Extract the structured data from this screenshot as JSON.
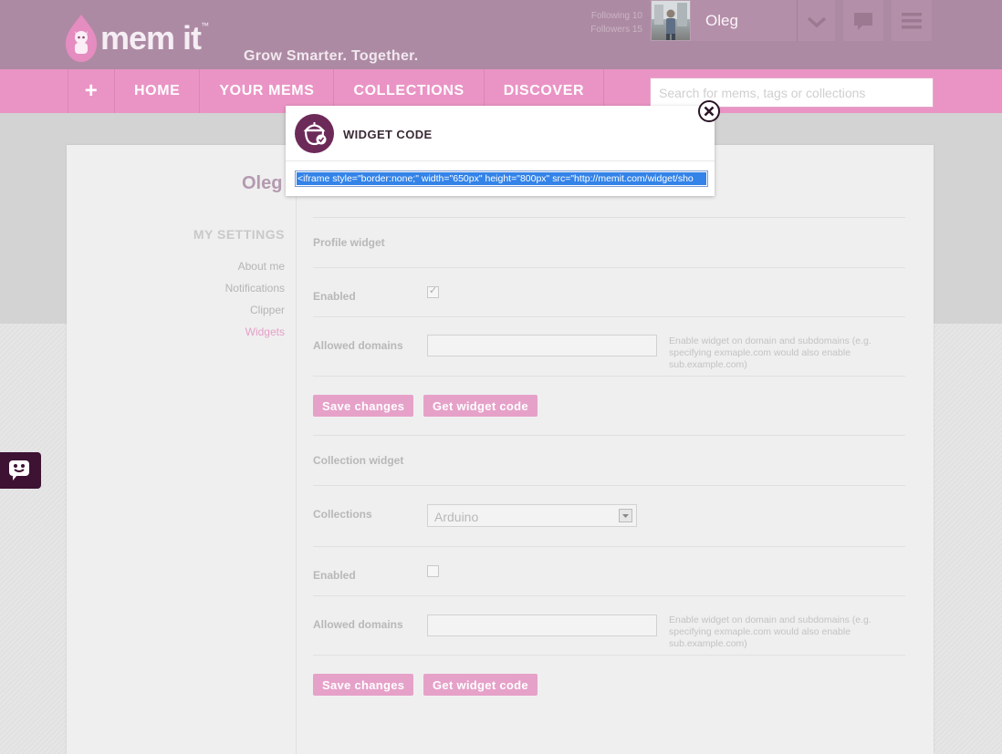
{
  "brand": {
    "logo_text": "mem it",
    "logo_tm": "™",
    "tagline": "Grow Smarter. Together."
  },
  "header": {
    "following": "Following 10",
    "followers": "Followers 15",
    "username": "Oleg"
  },
  "nav": {
    "add_label": "+",
    "items": [
      "HOME",
      "YOUR MEMS",
      "COLLECTIONS",
      "DISCOVER"
    ],
    "search_placeholder": "Search for mems, tags or collections"
  },
  "sidebar": {
    "profile_name": "Oleg",
    "title": "MY SETTINGS",
    "links": [
      "About me",
      "Notifications",
      "Clipper",
      "Widgets"
    ],
    "active_index": 3
  },
  "profile_widget": {
    "heading": "Profile widget",
    "enabled_label": "Enabled",
    "enabled_checked": true,
    "domains_label": "Allowed domains",
    "domains_value": "",
    "domains_help": "Enable widget on domain and subdomains (e.g. specifying exmaple.com would also enable sub.example.com)",
    "save_label": "Save changes",
    "code_label": "Get widget code"
  },
  "collection_widget": {
    "heading": "Collection widget",
    "collections_label": "Collections",
    "collection_selected": "Arduino",
    "enabled_label": "Enabled",
    "enabled_checked": false,
    "domains_label": "Allowed domains",
    "domains_value": "",
    "domains_help": "Enable widget on domain and subdomains (e.g. specifying exmaple.com would also enable sub.example.com)",
    "save_label": "Save changes",
    "code_label": "Get widget code"
  },
  "modal": {
    "title": "WIDGET CODE",
    "code": "<iframe style=\"border:none;\" width=\"650px\" height=\"800px\" src=\"http://memit.com/widget/sho"
  },
  "icons": {
    "logo": "mascot-logo-icon",
    "caret": "chevron-down-icon",
    "messages": "chat-bubble-icon",
    "menu": "hamburger-menu-icon",
    "feedback": "feedback-face-icon",
    "close": "close-circle-icon",
    "modal_logo": "acorn-badge-icon",
    "select_arrow": "triangle-down-icon"
  },
  "colors": {
    "accent_pink": "#ea94c5",
    "header_mauve": "#ad8aa3",
    "button_pink": "#e6a1c9",
    "dark_plum": "#3d1233"
  }
}
